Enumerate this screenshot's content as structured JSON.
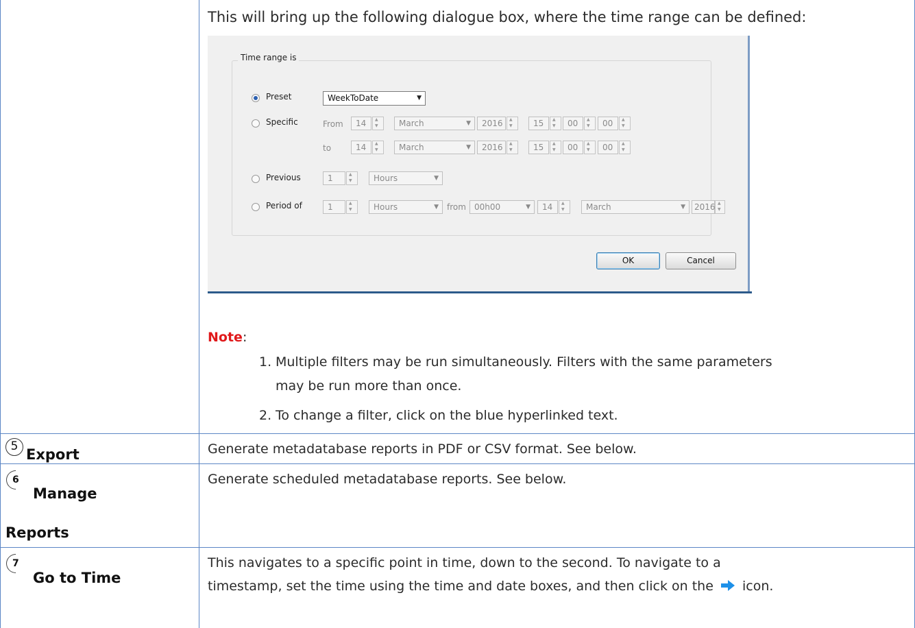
{
  "intro_text": "This will bring up the following dialogue box, where the time range can be defined:",
  "dialog": {
    "group_title": "Time range is",
    "preset_label": "Preset",
    "preset_value": "WeekToDate",
    "specific_label": "Specific",
    "from_label": "From",
    "to_label": "to",
    "specific_from": {
      "day": "14",
      "month": "March",
      "year": "2016",
      "hour": "15",
      "minute": "00",
      "second": "00"
    },
    "specific_to": {
      "day": "14",
      "month": "March",
      "year": "2016",
      "hour": "15",
      "minute": "00",
      "second": "00"
    },
    "previous_label": "Previous",
    "previous_count": "1",
    "previous_unit": "Hours",
    "period_label": "Period of",
    "period_count": "1",
    "period_unit": "Hours",
    "period_from_label": "from",
    "period_from_time": "00h00",
    "period_day": "14",
    "period_month": "March",
    "period_year": "2016",
    "ok_label": "OK",
    "cancel_label": "Cancel"
  },
  "note": {
    "label": "Note",
    "colon": ":",
    "items": [
      {
        "num": "1.",
        "line1": "Multiple filters may be run simultaneously. Filters with the same parameters",
        "line2": "may be run more than once."
      },
      {
        "num": "2.",
        "line1": "To change a filter, click on the blue hyperlinked text."
      }
    ]
  },
  "rows": [
    {
      "badge": "5",
      "label": "Export",
      "desc": "Generate metadatabase reports in PDF or CSV format. See below."
    },
    {
      "badge": "6",
      "label_line1": "Manage",
      "label_line2": "Reports",
      "desc": "Generate scheduled metadatabase reports. See below."
    },
    {
      "badge": "7",
      "label": "Go to Time",
      "desc_line1": "This navigates to a specific point in time, down to the second. To navigate to a",
      "desc_line2a": "timestamp, set the time using the time and date boxes, and then click on the",
      "desc_line2b": "icon.",
      "icon": "right-arrow-icon"
    }
  ],
  "colors": {
    "border": "#5b86c5",
    "note": "#e0191b",
    "arrow": "#1e90e8"
  }
}
